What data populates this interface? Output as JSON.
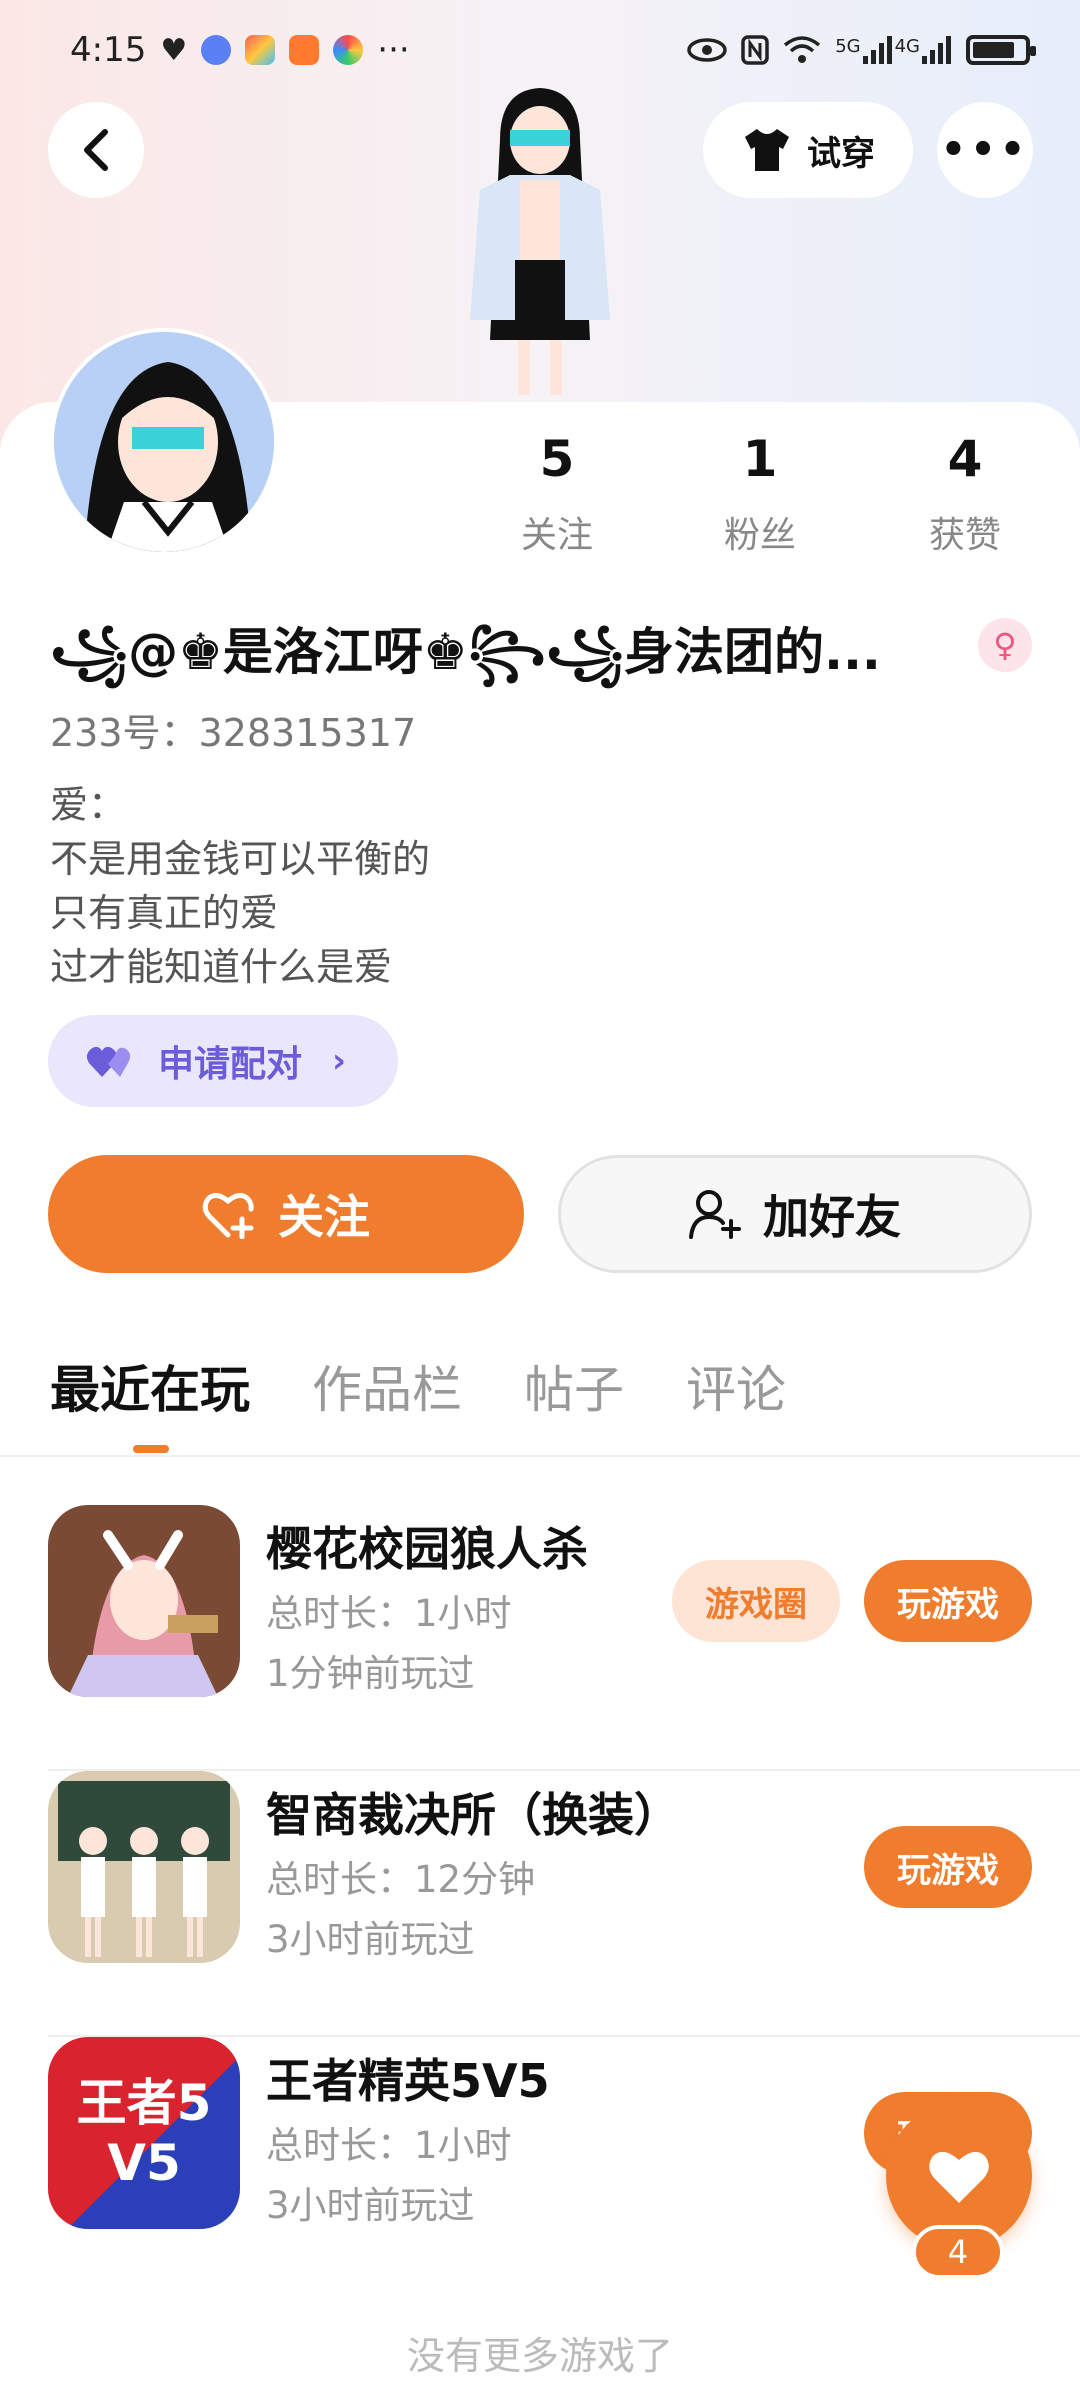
{
  "status_bar": {
    "time": "4:15",
    "more": "···",
    "network_1": "5G",
    "network_2": "4G",
    "icons": [
      "heart-icon",
      "music-app-icon",
      "app-icon",
      "play-app-icon",
      "browser-app-icon",
      "eye-icon",
      "nfc-icon",
      "wifi-icon",
      "signal-icon",
      "battery-icon"
    ]
  },
  "header": {
    "tryon_label": "试穿",
    "back_icon": "chevron-left-icon",
    "more_icon": "more-dots-icon"
  },
  "profile": {
    "stats": [
      {
        "value": "5",
        "label": "关注"
      },
      {
        "value": "1",
        "label": "粉丝"
      },
      {
        "value": "4",
        "label": "获赞"
      }
    ],
    "nickname": "꧁@♚是洛江呀♚꧂꧁身法团的...",
    "gender": "♀",
    "uid_label": "233号：",
    "uid": "328315317",
    "bio": [
      "爱：",
      "不是用金钱可以平衡的",
      "只有真正的爱",
      "过才能知道什么是爱"
    ],
    "pair_label": "申请配对",
    "pair_chevron": "›"
  },
  "actions": {
    "follow_label": "关注",
    "add_friend_label": "加好友"
  },
  "tabs": [
    {
      "label": "最近在玩",
      "active": true
    },
    {
      "label": "作品栏",
      "active": false
    },
    {
      "label": "帖子",
      "active": false
    },
    {
      "label": "评论",
      "active": false
    }
  ],
  "games": [
    {
      "name": "樱花校园狼人杀",
      "duration": "总时长：1小时",
      "last_played": "1分钟前玩过",
      "circle_label": "游戏圈",
      "play_label": "玩游戏"
    },
    {
      "name": "智商裁决所（换装）",
      "duration": "总时长：12分钟",
      "last_played": "3小时前玩过",
      "play_label": "玩游戏"
    },
    {
      "name": "王者精英5V5",
      "duration": "总时长：1小时",
      "last_played": "3小时前玩过",
      "play_label": "玩游戏",
      "icon_text": "王者5V5"
    }
  ],
  "floating_like_count": "4",
  "footer_note": "没有更多游戏了",
  "colors": {
    "accent": "#f07c2e",
    "pair_bg": "#eae6fb",
    "pair_fg": "#6b5cd9"
  }
}
